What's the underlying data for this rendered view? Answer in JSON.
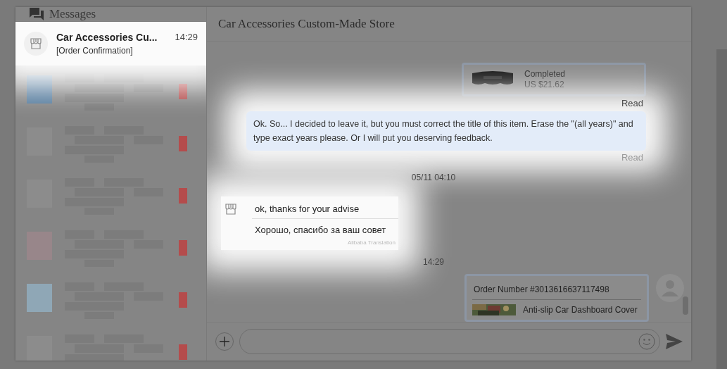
{
  "sidebar": {
    "title": "Messages",
    "conversations": [
      {
        "kind": "chat",
        "name": "Car Accessories Cu...",
        "time": "14:29",
        "preview": "[Order Confirmation]",
        "selected": true
      },
      {
        "kind": "redacted"
      },
      {
        "kind": "redacted"
      },
      {
        "kind": "redacted"
      },
      {
        "kind": "redacted"
      },
      {
        "kind": "redacted"
      },
      {
        "kind": "redacted"
      }
    ]
  },
  "chat": {
    "title": "Car Accessories Custom-Made Store",
    "messages": [
      {
        "kind": "order",
        "status": "Completed",
        "price": "US $21.62",
        "receipt": "Read"
      },
      {
        "kind": "outgoing",
        "text": "Ok. So... I decided to leave it, but you must correct the title of this item. Erase the \"(all years)\" and type exact years please. Or I will put you deserving feedback.",
        "receipt": "Read"
      },
      {
        "kind": "time",
        "text": "05/11 04:10"
      },
      {
        "kind": "incoming",
        "text": "ok, thanks for your advise",
        "translation": "Хорошо, спасибо за ваш совет",
        "source": "Alibaba Translation"
      },
      {
        "kind": "time",
        "text": "14:29"
      },
      {
        "kind": "order_sent",
        "order_number": "Order Number #3013616637117498",
        "product": "Anti-slip Car Dashboard Cover"
      }
    ]
  }
}
